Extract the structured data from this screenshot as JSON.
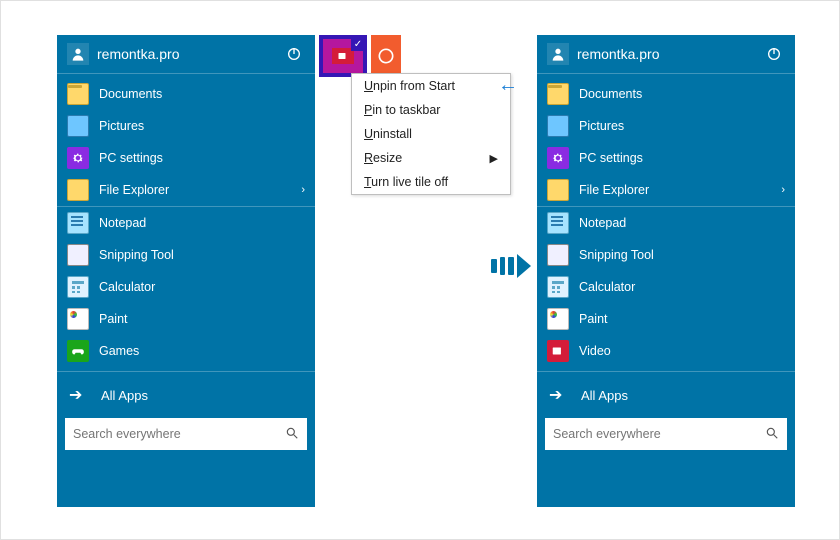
{
  "header": {
    "username": "remontka.pro"
  },
  "left": {
    "items": [
      {
        "label": "Documents",
        "icon": "folder",
        "expandable": false
      },
      {
        "label": "Pictures",
        "icon": "pic",
        "expandable": false
      },
      {
        "label": "PC settings",
        "icon": "gear",
        "expandable": false
      },
      {
        "label": "File Explorer",
        "icon": "fe",
        "expandable": true
      },
      {
        "label": "Notepad",
        "icon": "np",
        "expandable": false
      },
      {
        "label": "Snipping Tool",
        "icon": "sn",
        "expandable": false
      },
      {
        "label": "Calculator",
        "icon": "calc",
        "expandable": false
      },
      {
        "label": "Paint",
        "icon": "pnt",
        "expandable": false
      },
      {
        "label": "Games",
        "icon": "gm",
        "expandable": false
      }
    ]
  },
  "right": {
    "items": [
      {
        "label": "Documents",
        "icon": "folder"
      },
      {
        "label": "Pictures",
        "icon": "pic"
      },
      {
        "label": "PC settings",
        "icon": "gear"
      },
      {
        "label": "File Explorer",
        "icon": "fe",
        "expandable": true
      },
      {
        "label": "Notepad",
        "icon": "np"
      },
      {
        "label": "Snipping Tool",
        "icon": "sn"
      },
      {
        "label": "Calculator",
        "icon": "calc"
      },
      {
        "label": "Paint",
        "icon": "pnt"
      },
      {
        "label": "Video",
        "icon": "vid"
      }
    ]
  },
  "allapps_label": "All Apps",
  "search_placeholder": "Search everywhere",
  "context_menu": {
    "items": [
      {
        "label": "Unpin from Start",
        "submenu": false,
        "highlighted": true
      },
      {
        "label": "Pin to taskbar",
        "submenu": false
      },
      {
        "label": "Uninstall",
        "submenu": false
      },
      {
        "label": "Resize",
        "submenu": true
      },
      {
        "label": "Turn live tile off",
        "submenu": false
      }
    ]
  }
}
